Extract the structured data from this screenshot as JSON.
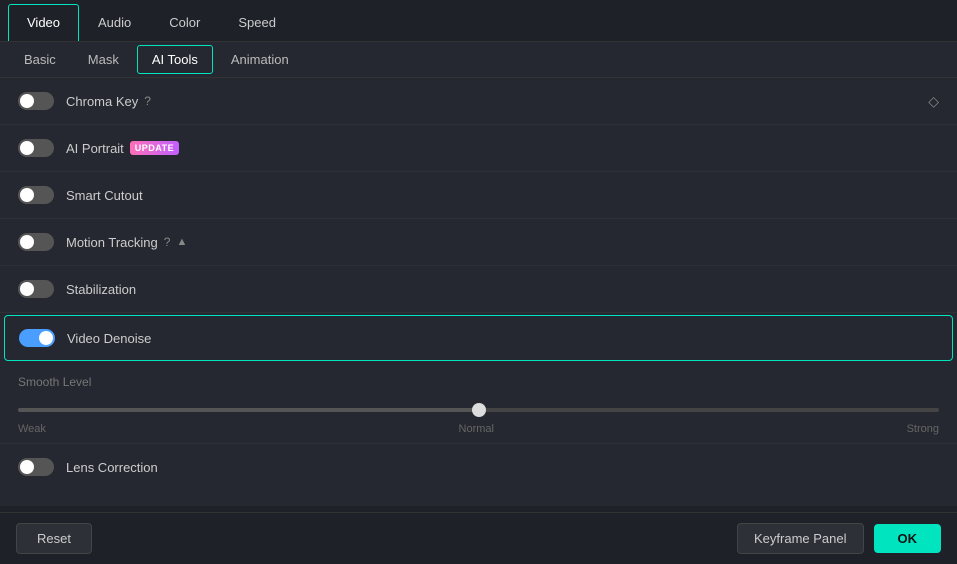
{
  "topTabs": [
    {
      "id": "video",
      "label": "Video",
      "active": true
    },
    {
      "id": "audio",
      "label": "Audio",
      "active": false
    },
    {
      "id": "color",
      "label": "Color",
      "active": false
    },
    {
      "id": "speed",
      "label": "Speed",
      "active": false
    }
  ],
  "subTabs": [
    {
      "id": "basic",
      "label": "Basic",
      "active": false
    },
    {
      "id": "mask",
      "label": "Mask",
      "active": false
    },
    {
      "id": "ai-tools",
      "label": "AI Tools",
      "active": true
    },
    {
      "id": "animation",
      "label": "Animation",
      "active": false
    }
  ],
  "rows": [
    {
      "id": "chroma-key",
      "label": "Chroma Key",
      "toggle": true,
      "on": false,
      "helpIcon": true,
      "diamond": true,
      "badge": null,
      "arrow": false,
      "highlighted": false
    },
    {
      "id": "ai-portrait",
      "label": "AI Portrait",
      "toggle": true,
      "on": false,
      "helpIcon": false,
      "diamond": false,
      "badge": "UPDATE",
      "arrow": false,
      "highlighted": false
    },
    {
      "id": "smart-cutout",
      "label": "Smart Cutout",
      "toggle": true,
      "on": false,
      "helpIcon": false,
      "diamond": false,
      "badge": null,
      "arrow": false,
      "highlighted": false
    },
    {
      "id": "motion-tracking",
      "label": "Motion Tracking",
      "toggle": true,
      "on": false,
      "helpIcon": true,
      "diamond": false,
      "badge": null,
      "arrow": true,
      "highlighted": false
    },
    {
      "id": "stabilization",
      "label": "Stabilization",
      "toggle": true,
      "on": false,
      "helpIcon": false,
      "diamond": false,
      "badge": null,
      "arrow": false,
      "highlighted": false
    },
    {
      "id": "video-denoise",
      "label": "Video Denoise",
      "toggle": true,
      "on": false,
      "helpIcon": false,
      "diamond": false,
      "badge": null,
      "arrow": false,
      "highlighted": true
    }
  ],
  "smoothSection": {
    "label": "Smooth Level",
    "sliderValue": 50,
    "labels": {
      "left": "Weak",
      "center": "Normal",
      "right": "Strong"
    }
  },
  "lensCorrection": {
    "label": "Lens Correction",
    "toggle": true,
    "on": false
  },
  "footer": {
    "reset": "Reset",
    "keyframePanel": "Keyframe Panel",
    "ok": "OK"
  }
}
